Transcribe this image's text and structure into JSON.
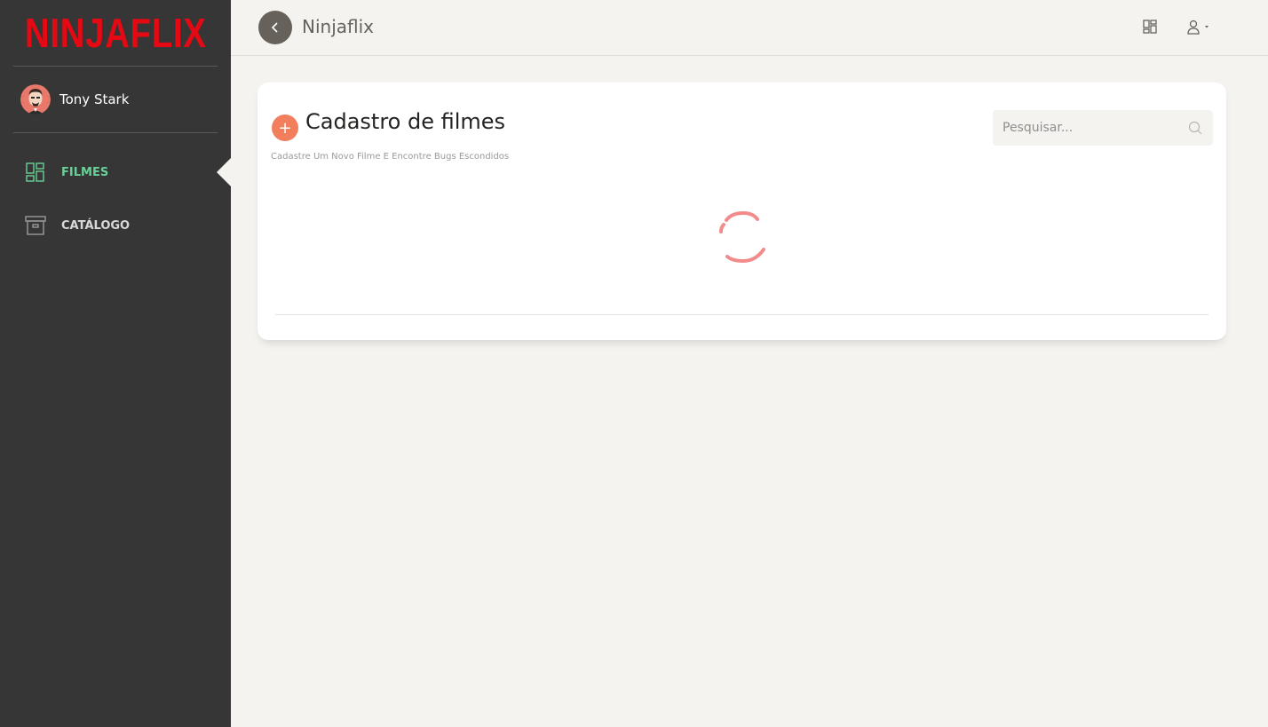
{
  "sidebar": {
    "logo_text": "NINJAFLIX",
    "user": {
      "name": "Tony Stark"
    },
    "items": [
      {
        "label": "FILMES",
        "icon": "dashboard-icon",
        "active": true
      },
      {
        "label": "CATÁLOGO",
        "icon": "archive-icon",
        "active": false
      }
    ]
  },
  "topbar": {
    "brand": "Ninjaflix",
    "icons": [
      "back-arrow-icon",
      "dashboard-icon",
      "user-icon",
      "caret-down-icon"
    ]
  },
  "card": {
    "title": "Cadastro de filmes",
    "subtitle": "Cadastre Um Novo Filme E Encontre Bugs Escondidos",
    "add_symbol": "+",
    "search": {
      "placeholder": "Pesquisar..."
    },
    "loading": true
  },
  "colors": {
    "sidebar_bg": "#363636",
    "accent_green": "#6bd098",
    "logo_red": "#e50914",
    "add_orange": "#f17e5d",
    "spinner": "#f28b8b",
    "page_bg": "#f4f3ef"
  }
}
